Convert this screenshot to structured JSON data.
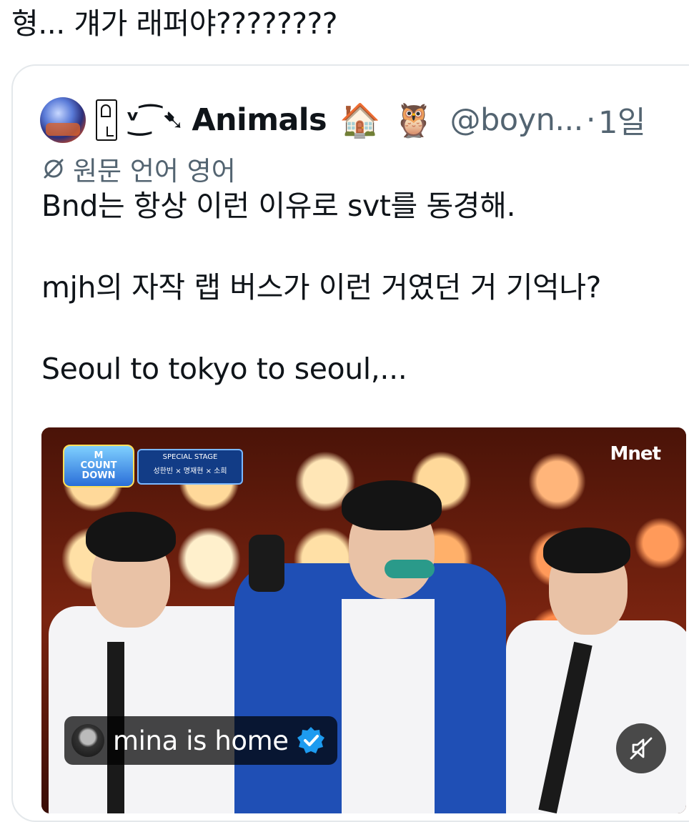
{
  "tweet": {
    "text": "형... 걔가 래퍼야????????"
  },
  "quoted_tweet": {
    "decoration": "ᵛ͜⁀➷",
    "display_name": "Animals",
    "name_emojis": [
      "🏠",
      "🦉"
    ],
    "handle": "@boyn...",
    "separator": "·",
    "timestamp": "1일",
    "translation_note": "원문 언어 영어",
    "body": [
      "Bnd는 항상 이런 이유로 svt를 동경해.",
      "mjh의 자작 랩 버스가 이런 거였던 거 기억나?",
      "Seoul to tokyo to seoul,..."
    ],
    "media": {
      "type": "video",
      "overlay_logo_left": [
        "M",
        "COUNT",
        "DOWN"
      ],
      "overlay_banner": [
        "SPECIAL STAGE",
        "성한빈 × 명재현 × 소희"
      ],
      "overlay_logo_right": "Mnet",
      "source_account_name": "mina is home",
      "source_verified": true,
      "muted": true
    }
  },
  "colors": {
    "text_primary": "#0f1419",
    "text_secondary": "#536471",
    "border": "#e4e8eb",
    "verified_blue": "#1d9bf0"
  },
  "icons": {
    "translate": "translate-icon",
    "verified": "verified-badge-icon",
    "mute": "speaker-muted-icon"
  }
}
